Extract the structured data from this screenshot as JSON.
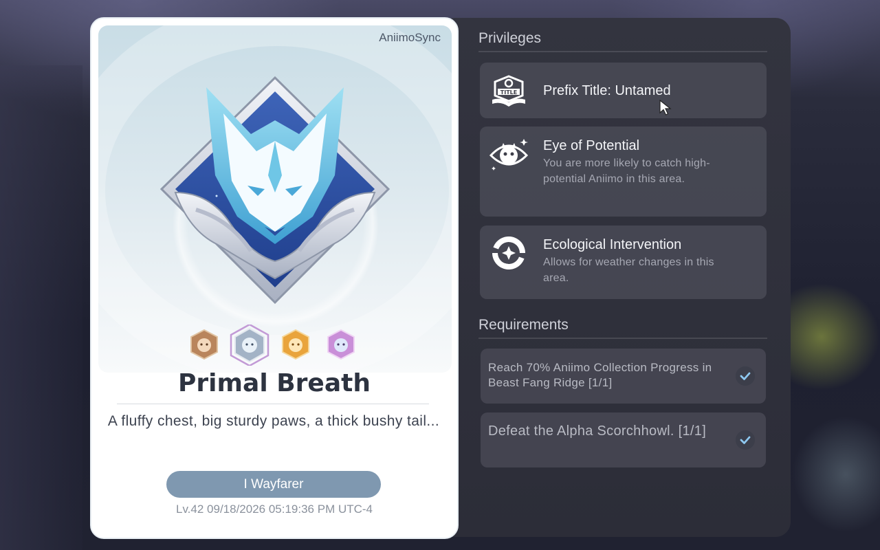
{
  "badge": {
    "brand": "AniimoSync",
    "title": "Primal Breath",
    "description": "A fluffy chest, big sturdy paws, a thick bushy tail...",
    "button_label": "I Wayfarer",
    "stamp": "Lv.42 09/18/2026 05:19:36 PM UTC-4",
    "medals": [
      "medal-brown-icon",
      "medal-silver-selected-icon",
      "medal-orange-icon",
      "medal-pink-icon"
    ]
  },
  "privileges": {
    "heading": "Privileges",
    "items": [
      {
        "title": "Prefix Title: Untamed",
        "description": "",
        "icon": "title-book-icon"
      },
      {
        "title": "Eye of Potential",
        "description": "You are more likely to catch high-potential Aniimo in this area.",
        "icon": "eye-icon"
      },
      {
        "title": "Ecological Intervention",
        "description": "Allows for weather changes in this area.",
        "icon": "weather-swirl-icon"
      }
    ]
  },
  "requirements": {
    "heading": "Requirements",
    "items": [
      {
        "text": "Reach 70% Aniimo Collection Progress in Beast Fang Ridge [1/1]",
        "done": true
      },
      {
        "text": "Defeat the Alpha Scorchhowl. [1/1]",
        "done": true
      }
    ]
  },
  "colors": {
    "accent_check": "#8ec8f0",
    "button": "#7f98b0",
    "emblem_blue": "#2b4fa0",
    "emblem_cyan": "#6fc6e6"
  }
}
